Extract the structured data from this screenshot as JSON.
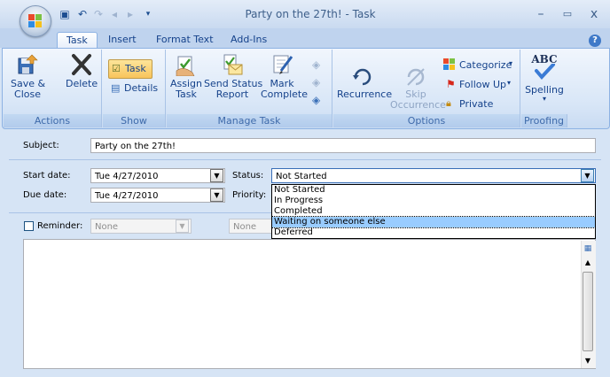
{
  "window": {
    "title": "Party on the 27th! - Task",
    "minimize": "–",
    "maximize": "▭",
    "close": "x"
  },
  "tabs": [
    {
      "label": "Task",
      "active": true
    },
    {
      "label": "Insert"
    },
    {
      "label": "Format Text"
    },
    {
      "label": "Add-Ins"
    }
  ],
  "ribbon": {
    "actions": {
      "label": "Actions",
      "save_close": "Save &\nClose",
      "delete": "Delete"
    },
    "show": {
      "label": "Show",
      "task": "Task",
      "details": "Details"
    },
    "manage": {
      "label": "Manage Task",
      "assign": "Assign\nTask",
      "send_status": "Send Status\nReport",
      "mark_complete": "Mark\nComplete"
    },
    "options": {
      "label": "Options",
      "recurrence": "Recurrence",
      "skip": "Skip\nOccurrence",
      "categorize": "Categorize",
      "follow_up": "Follow Up",
      "private": "Private"
    },
    "proofing": {
      "label": "Proofing",
      "spelling": "Spelling",
      "abc": "ABC"
    }
  },
  "form": {
    "subject_label": "Subject:",
    "subject_value": "Party on the 27th!",
    "start_label": "Start date:",
    "start_value": "Tue 4/27/2010",
    "due_label": "Due date:",
    "due_value": "Tue 4/27/2010",
    "status_label": "Status:",
    "status_value": "Not Started",
    "priority_label": "Priority:",
    "reminder_label": "Reminder:",
    "reminder_date": "None",
    "reminder_time": "None",
    "status_options": [
      "Not Started",
      "In Progress",
      "Completed",
      "Waiting on someone else",
      "Deferred"
    ],
    "status_highlight_index": 3
  },
  "colors": {
    "accent": "#15428b",
    "highlight": "#99ccff"
  }
}
